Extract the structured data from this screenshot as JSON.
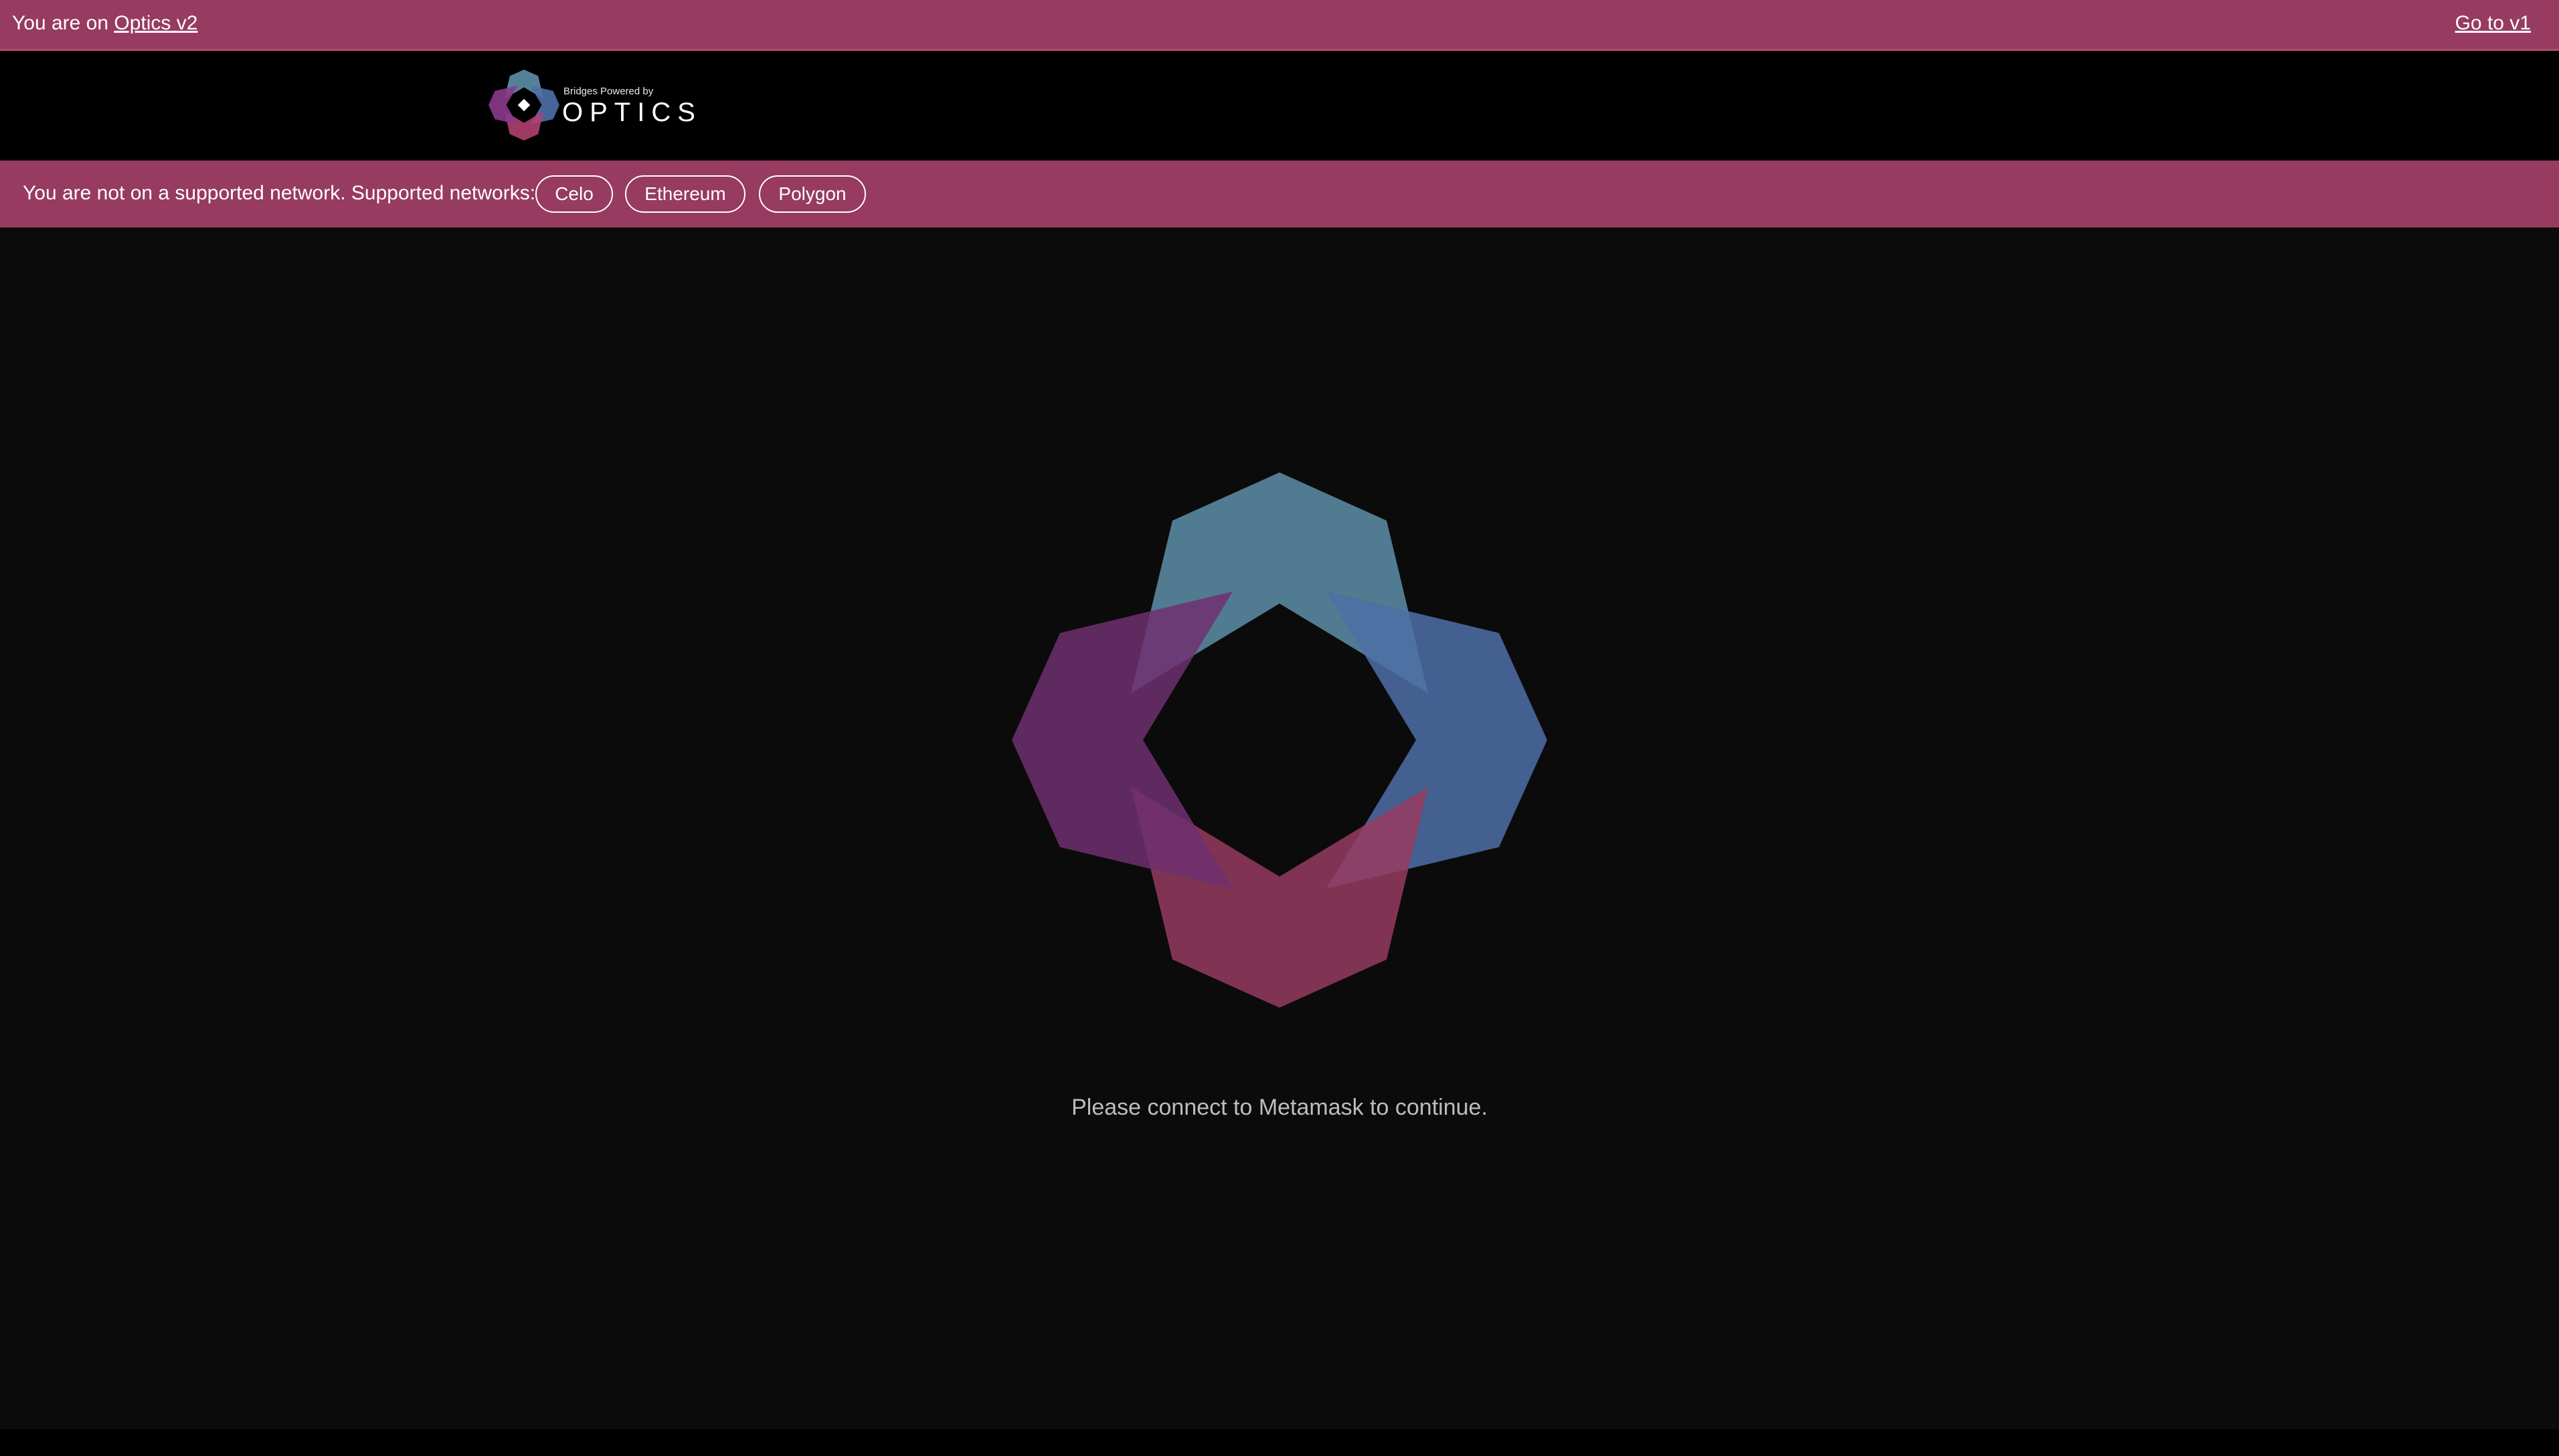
{
  "banner": {
    "prefix": "You are on",
    "version_link": "Optics v2",
    "switch_link": "Go to v1"
  },
  "logo": {
    "tagline": "Bridges Powered by",
    "wordmark": "OPTICS"
  },
  "network_bar": {
    "message": "You are not on a supported network. Supported networks:",
    "networks": [
      "Celo",
      "Ethereum",
      "Polygon"
    ]
  },
  "main": {
    "connect_message": "Please connect to Metamask to continue."
  },
  "colors": {
    "banner": "#973b60",
    "background": "#0b0b0b",
    "petal_teal": "#5e8fa8",
    "petal_blue": "#4e70a8",
    "petal_purple": "#6e3070",
    "petal_pink": "#973b60"
  }
}
